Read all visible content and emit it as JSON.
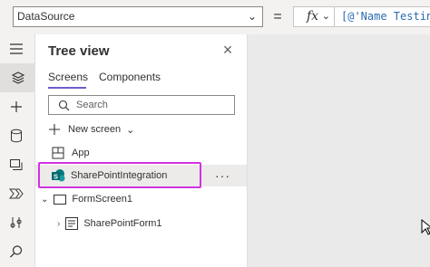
{
  "formula_bar": {
    "property": "DataSource",
    "equals": "=",
    "fx": "fx",
    "formula": "[@'Name Testin"
  },
  "tree_view": {
    "title": "Tree view",
    "tabs": [
      "Screens",
      "Components"
    ],
    "search_placeholder": "Search",
    "new_screen_label": "New screen",
    "items": {
      "app": "App",
      "sharepoint": "SharePointIntegration",
      "formscreen": "FormScreen1",
      "sharepointform": "SharePointForm1"
    },
    "more": "···"
  },
  "colors": {
    "accent": "#6b5fc8",
    "highlight": "#d033e0",
    "sharepoint": "#0b7a75"
  }
}
